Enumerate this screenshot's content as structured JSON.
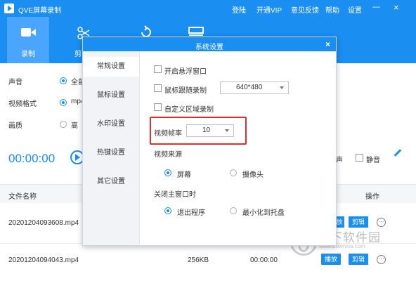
{
  "window": {
    "title": "QVE屏幕录制"
  },
  "top_menu": [
    "登陆",
    "开通VIP",
    "意见反馈",
    "帮助",
    "设置"
  ],
  "toolbar": {
    "record_label": "录制",
    "second_label": "剪"
  },
  "main": {
    "audio_label": "声音",
    "audio_option": "全部",
    "format_label": "视频格式",
    "format_option": "mp4",
    "quality_label": "画质",
    "quality_option": "高",
    "timer": "00:00:00",
    "mic_label": "声",
    "mute_label": "静音"
  },
  "list": {
    "headers": {
      "name": "文件名称",
      "action": "操作"
    },
    "rows": [
      {
        "name": "20201204093608.mp4",
        "play": "放",
        "edit": "剪辑",
        "more": "···"
      },
      {
        "name": "20201204094043.mp4",
        "size": "256KB",
        "duration": "00:00:00",
        "play": "播放",
        "edit": "剪辑",
        "more": "···"
      }
    ]
  },
  "dialog": {
    "title": "系统设置",
    "close": "×",
    "sidebar": [
      "常规设置",
      "鼠标设置",
      "水印设置",
      "热键设置",
      "其它设置"
    ],
    "options": {
      "float_window": "开启悬浮窗口",
      "follow_mouse": "鼠标跟随录制",
      "follow_size": "640*480",
      "custom_area": "自定义区域录制",
      "fps_label": "视频帧率",
      "fps_value": "10",
      "source_label": "视频来源",
      "source_screen": "屏幕",
      "source_camera": "摄像头",
      "close_label": "关闭主窗口时",
      "close_exit": "退出程序",
      "close_tray": "最小化到托盘"
    }
  },
  "watermark": {
    "text": "当下软件园",
    "url": "www.downxia.com"
  },
  "colors": {
    "accent": "#1b8ef2",
    "highlight": "#e03030"
  }
}
